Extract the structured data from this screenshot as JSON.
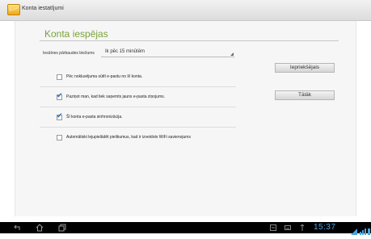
{
  "window": {
    "title": "Konta iestatījumi",
    "icon": "email-settings-icon"
  },
  "page": {
    "title": "Konta iespējas"
  },
  "check_interval": {
    "label": "Iesūtnes pārbaudes biežums",
    "value": "Ik pēc 15 minūtēm"
  },
  "options": [
    {
      "label": "Pēc noklusējuma sūtīt e-pastu no šī konta.",
      "checked": false
    },
    {
      "label": "Paziņot man, kad tiek saņemts jauns e-pasta ziņojums.",
      "checked": true
    },
    {
      "label": "Šī konta e-pasta sinhronizācija.",
      "checked": true
    },
    {
      "label": "Automātiski lejupielādēt pielikumus, kad ir izveidots WiFi savienojums",
      "checked": false
    }
  ],
  "buttons": {
    "previous": "Iepriekšējais",
    "next": "Tālāk"
  },
  "status_bar": {
    "clock": "15:37",
    "accent": "#4aa3e0"
  }
}
